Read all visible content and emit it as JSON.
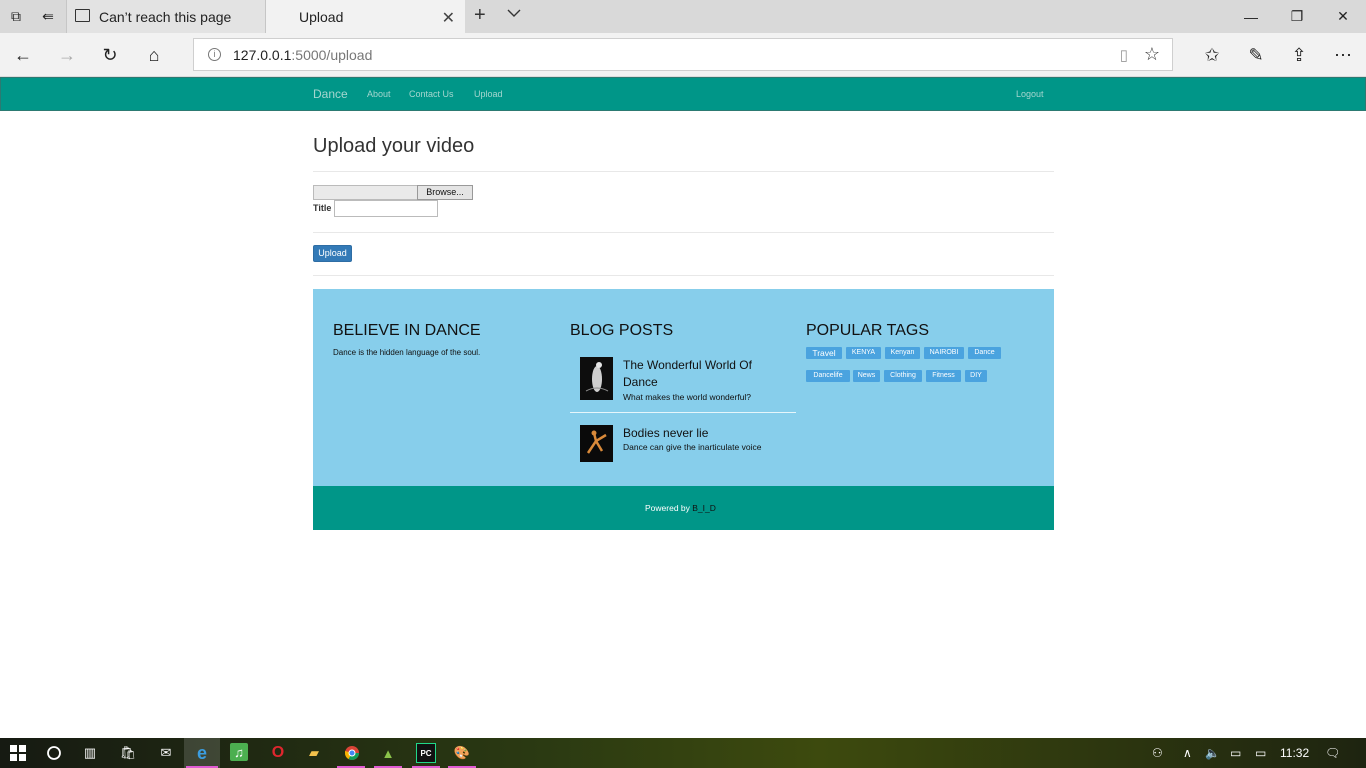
{
  "browser": {
    "tabs": [
      {
        "label": "Can’t reach this page"
      },
      {
        "label": "Upload"
      }
    ],
    "url_host": "127.0.0.1",
    "url_path": ":5000/upload"
  },
  "site": {
    "brand": "Dance",
    "nav": [
      "About",
      "Contact Us",
      "Upload"
    ],
    "logout": "Logout"
  },
  "upload": {
    "heading": "Upload your video",
    "browse_label": "Browse...",
    "title_label": "Title",
    "title_value": "",
    "submit_label": "Upload"
  },
  "footer": {
    "about_heading": "BELIEVE IN DANCE",
    "about_text": "Dance is the hidden language of the soul.",
    "blog_heading": "BLOG POSTS",
    "posts": [
      {
        "title": "The Wonderful World Of Dance",
        "subtitle": "What makes the world wonderful?"
      },
      {
        "title": "Bodies never lie",
        "subtitle": "Dance can give the inarticulate voice"
      }
    ],
    "tags_heading": "POPULAR TAGS",
    "tags": [
      "Travel",
      "KENYA",
      "Kenyan",
      "NAIROBI",
      "Dance",
      "Dancelife",
      "News",
      "Clothing",
      "Fitness",
      "DIY"
    ],
    "powered_by": "Powered by",
    "powered_name": "B_I_D"
  },
  "taskbar": {
    "time": "11:32"
  },
  "colors": {
    "primary": "#009688",
    "footer_bg": "#87ceeb",
    "button": "#337ab7",
    "tag": "#4aa3df"
  }
}
